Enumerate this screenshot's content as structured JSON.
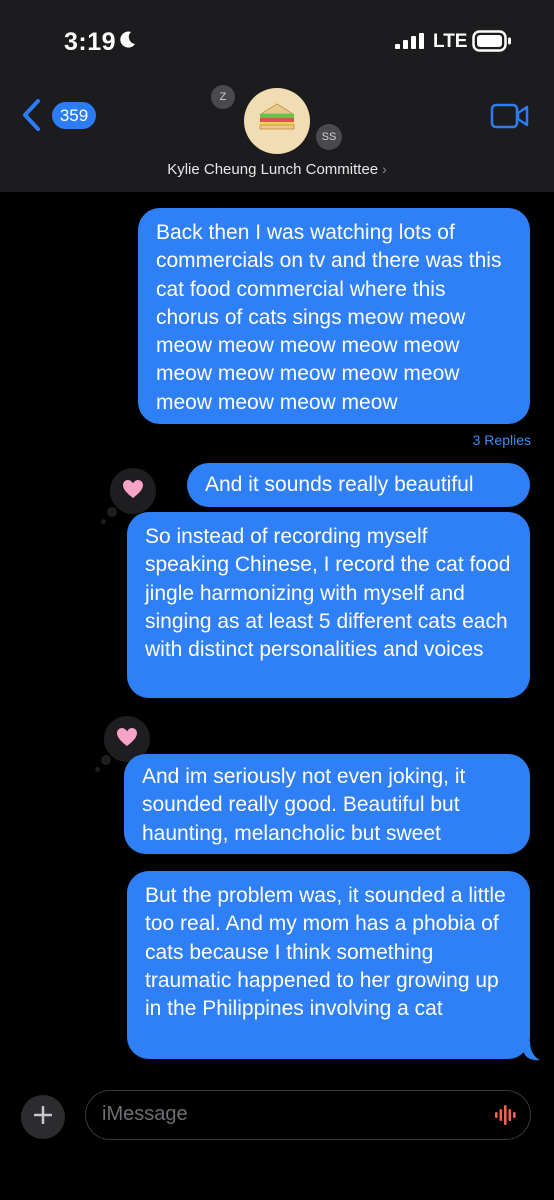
{
  "status_bar": {
    "time": "3:19",
    "network": "LTE"
  },
  "header": {
    "back_count": "359",
    "group_name": "Kylie Cheung Lunch Committee",
    "member_initials": [
      "Z",
      "SS"
    ]
  },
  "messages": [
    {
      "text": "Back then I was watching lots of commercials on tv and there was this cat food commercial where this chorus of cats sings meow meow meow meow meow meow meow meow meow meow meow meow meow meow meow meow",
      "replies": "3 Replies"
    },
    {
      "text": "And it sounds really beautiful",
      "reaction": "heart"
    },
    {
      "text": "So instead of recording myself speaking Chinese, I record the cat food jingle harmonizing with myself and singing as at least 5 different cats each with distinct personalities and voices"
    },
    {
      "text": "And im seriously not even joking, it sounded really good. Beautiful but haunting, melancholic but sweet",
      "reaction": "heart"
    },
    {
      "text": "But the problem was, it sounded a little too real. And my mom has a phobia of cats because I think something traumatic happened to her growing up in the Philippines involving a cat"
    }
  ],
  "composer": {
    "placeholder": "iMessage"
  },
  "colors": {
    "bubble": "#2f7ff7",
    "accent": "#2c7cf6",
    "reaction": "#f7a3c8"
  }
}
